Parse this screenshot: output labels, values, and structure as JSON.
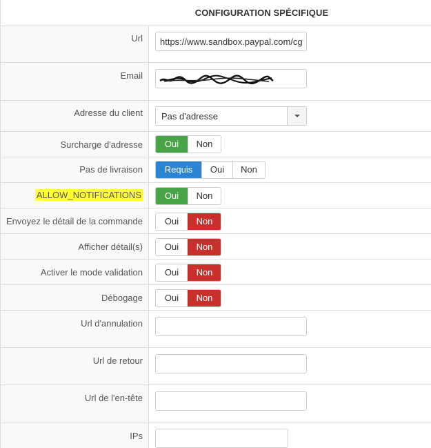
{
  "header": {
    "title": "CONFIGURATION SPÉCIFIQUE"
  },
  "fields": {
    "url": {
      "label": "Url",
      "value": "https://www.sandbox.paypal.com/cgi-bin/webscr"
    },
    "email": {
      "label": "Email"
    },
    "client_address": {
      "label": "Adresse du client",
      "selected": "Pas d'adresse"
    },
    "address_override": {
      "label": "Surcharge d'adresse",
      "yes": "Oui",
      "no": "Non",
      "active": "yes"
    },
    "no_shipping": {
      "label": "Pas de livraison",
      "required": "Requis",
      "yes": "Oui",
      "no": "Non",
      "active": "required"
    },
    "allow_notifications": {
      "label": "ALLOW_NOTIFICATIONS",
      "yes": "Oui",
      "no": "Non",
      "active": "yes"
    },
    "send_order_detail": {
      "label": "Envoyez le détail de la commande",
      "yes": "Oui",
      "no": "Non",
      "active": "no"
    },
    "show_details": {
      "label": "Afficher détail(s)",
      "yes": "Oui",
      "no": "Non",
      "active": "no"
    },
    "validation_mode": {
      "label": "Activer le mode validation",
      "yes": "Oui",
      "no": "Non",
      "active": "no"
    },
    "debug": {
      "label": "Débogage",
      "yes": "Oui",
      "no": "Non",
      "active": "no"
    },
    "cancel_url": {
      "label": "Url d'annulation",
      "value": ""
    },
    "return_url": {
      "label": "Url de retour",
      "value": ""
    },
    "header_url": {
      "label": "Url de l'en-tête",
      "value": ""
    },
    "ips": {
      "label": "IPs",
      "value": ""
    }
  },
  "colors": {
    "green": "#47a447",
    "red": "#c9302c",
    "blue": "#2a84d2",
    "highlight": "#ffff33"
  }
}
